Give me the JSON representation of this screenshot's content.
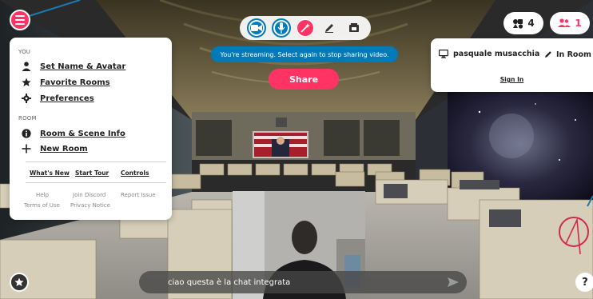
{
  "toolbar": {
    "stream_banner": "You're streaming. Select again to stop sharing video.",
    "share_label": "Share",
    "object_count": "4",
    "people_count": "1",
    "accent_color": "#ff3464",
    "blue_color": "#007ab8"
  },
  "menu": {
    "section_you": "YOU",
    "section_room": "ROOM",
    "items_you": [
      {
        "label": "Set Name & Avatar",
        "icon": "person-icon"
      },
      {
        "label": "Favorite Rooms",
        "icon": "star-icon"
      },
      {
        "label": "Preferences",
        "icon": "gear-icon"
      }
    ],
    "items_room": [
      {
        "label": "Room & Scene Info",
        "icon": "info-icon"
      },
      {
        "label": "New Room",
        "icon": "plus-icon"
      }
    ],
    "links": [
      "What's New",
      "Start Tour",
      "Controls"
    ],
    "footer_row1": [
      "Help",
      "Join Discord",
      "Report Issue"
    ],
    "footer_row2": [
      "Terms of Use",
      "Privacy Notice"
    ]
  },
  "profile": {
    "username": "pasquale musacchia",
    "presence": "In Room",
    "sign_in": "Sign In"
  },
  "chat": {
    "text": "ciao questa è la chat integrata"
  },
  "help": {
    "label": "?"
  }
}
